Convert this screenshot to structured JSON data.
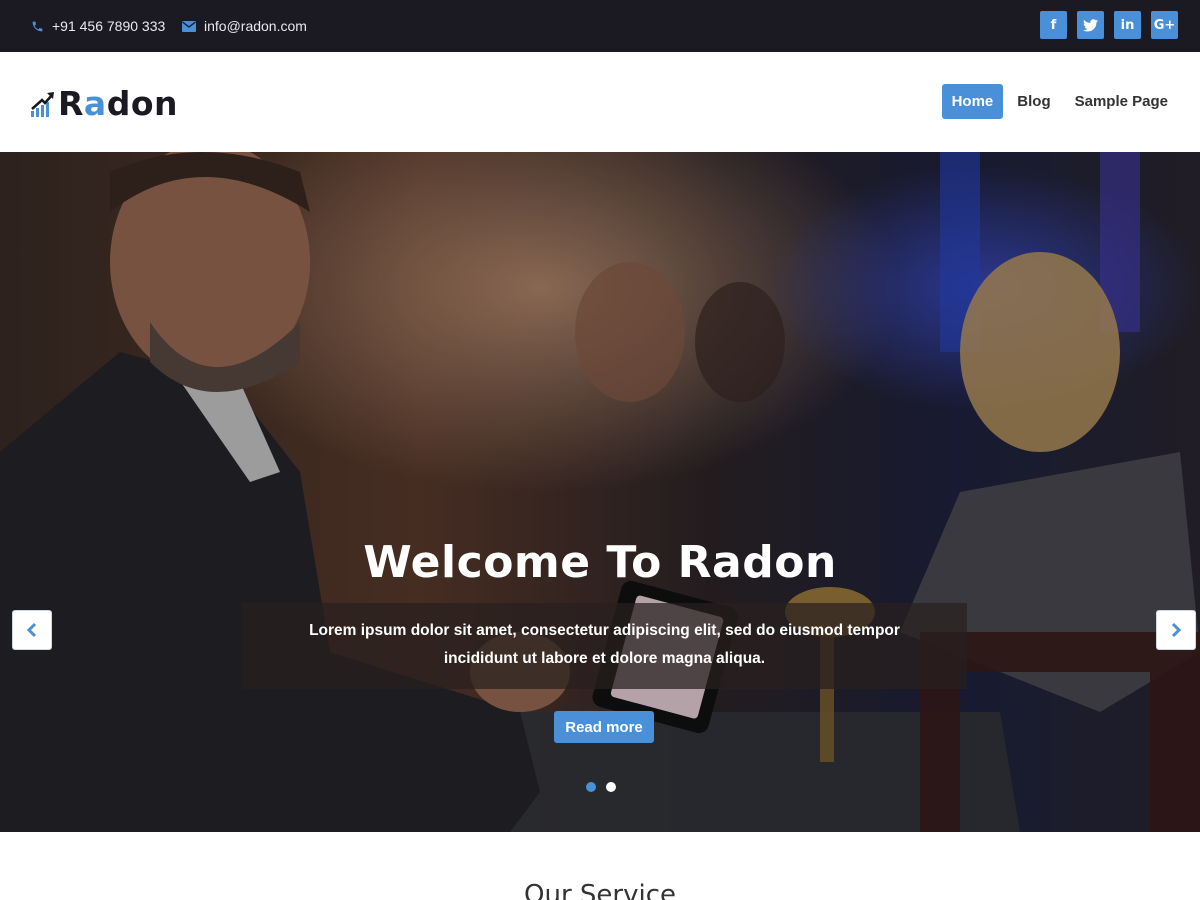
{
  "topbar": {
    "phone": "+91 456 7890 333",
    "email": "info@radon.com",
    "social": [
      {
        "icon": "facebook-icon",
        "glyph": "f"
      },
      {
        "icon": "twitter-icon",
        "glyph": "t"
      },
      {
        "icon": "linkedin-icon",
        "glyph": "in"
      },
      {
        "icon": "google-plus-icon",
        "glyph": "G+"
      }
    ]
  },
  "header": {
    "logo_text_start": "R",
    "logo_text_accent": "a",
    "logo_text_end": "don",
    "nav": [
      "Home",
      "Blog",
      "Sample Page"
    ]
  },
  "hero": {
    "title": "Welcome To Radon",
    "text": "Lorem ipsum dolor sit amet, consectetur adipiscing elit, sed do eiusmod tempor incididunt ut labore et dolore magna aliqua.",
    "button": "Read more",
    "slide_count": 2,
    "active_slide": 1
  },
  "services": {
    "heading": "Our Service"
  },
  "colors": {
    "accent": "#4a90d9",
    "topbar": "#1b1a22"
  }
}
